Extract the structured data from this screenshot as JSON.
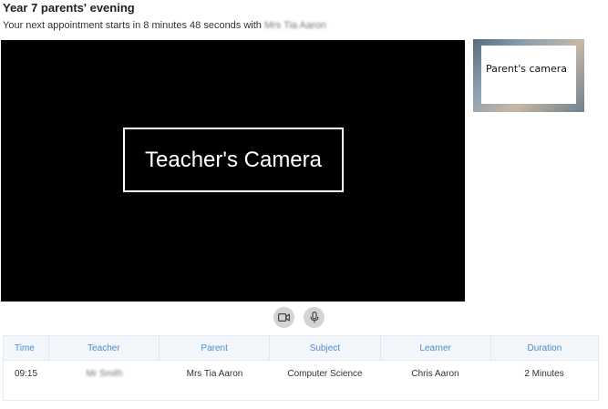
{
  "page": {
    "title": "Year 7 parents' evening",
    "subtitle_prefix": "Your next appointment starts in 8 minutes 48 seconds with",
    "subtitle_name": "Mrs Tia Aaron"
  },
  "video": {
    "teacher_label": "Teacher's Camera",
    "parent_label": "Parent's camera"
  },
  "controls": {
    "camera_icon": "video-camera-icon",
    "mic_icon": "microphone-icon"
  },
  "schedule": {
    "headers": [
      "Time",
      "Teacher",
      "Parent",
      "Subject",
      "Learner",
      "Duration"
    ],
    "rows": [
      {
        "time": "09:15",
        "teacher": "Mr Smith",
        "parent": "Mrs Tia Aaron",
        "subject": "Computer Science",
        "learner": "Chris Aaron",
        "duration": "2 Minutes"
      }
    ]
  },
  "colors": {
    "header_text": "#4a8ccf",
    "header_bg": "#f3f7fb",
    "video_bg": "#000000"
  }
}
